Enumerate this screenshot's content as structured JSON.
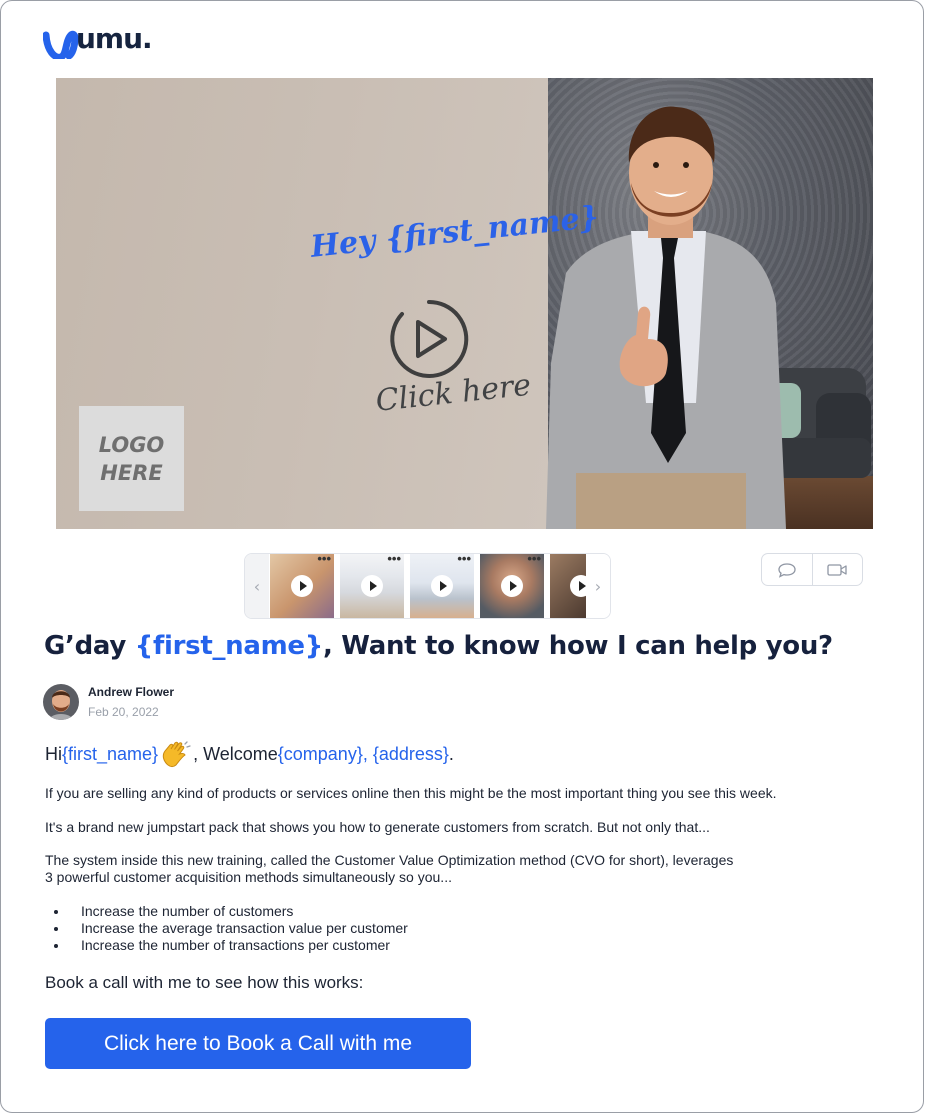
{
  "brand": {
    "wordmark": "umu."
  },
  "video": {
    "overlay_greeting": "Hey {first_name}",
    "overlay_cta": "Click here",
    "logo_placeholder_line1": "LOGO",
    "logo_placeholder_line2": "HERE"
  },
  "thumbnails": {
    "prev_icon": "‹",
    "next_icon": "›",
    "items": [
      {
        "name": "thumb-woman",
        "more": "•••"
      },
      {
        "name": "thumb-screen",
        "more": "•••"
      },
      {
        "name": "thumb-screen-man",
        "more": "•••"
      },
      {
        "name": "thumb-man-laugh",
        "more": "•••"
      },
      {
        "name": "thumb-partial"
      }
    ]
  },
  "actions": [
    {
      "icon": "comment-icon"
    },
    {
      "icon": "video-camera-icon"
    }
  ],
  "post": {
    "title_prefix": "G’day ",
    "title_var": "{first_name}",
    "title_suffix": ", Want to know how I can help you?",
    "author_name": "Andrew Flower",
    "date": "Feb 20, 2022",
    "greeting_hi": "Hi ",
    "greeting_var1": "{first_name}",
    "greeting_welcome": ", Welcome ",
    "greeting_var2": "{company}, {address}",
    "greeting_end": ".",
    "paragraph1": "If you are selling any kind of products or services online then this might be the most important thing you see this week.",
    "paragraph2": "It's a brand new jumpstart pack that shows you how to generate customers from scratch. But not only that...",
    "paragraph3_line1": "The system inside this new training, called the Customer Value Optimization method (CVO for short), leverages",
    "paragraph3_line2": "3 powerful customer acquisition methods simultaneously so you...",
    "bullets": [
      "Increase the number of customers",
      "Increase the average transaction value per customer",
      "Increase the number of transactions per customer"
    ],
    "book_label": "Book a call with me to see how this works:",
    "cta_label": "Click here to Book a Call with me"
  },
  "colors": {
    "accent": "#2563eb",
    "heading": "#16213d",
    "overlay_blue": "#2b62e8"
  }
}
